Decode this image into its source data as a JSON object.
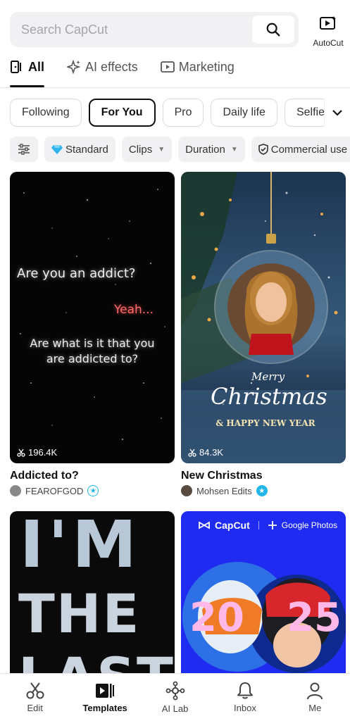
{
  "search": {
    "placeholder": "Search CapCut"
  },
  "autocut": {
    "label": "AutoCut"
  },
  "main_tabs": [
    {
      "label": "All",
      "active": true
    },
    {
      "label": "AI effects",
      "active": false
    },
    {
      "label": "Marketing",
      "active": false
    }
  ],
  "chips": [
    {
      "label": "Following",
      "active": false
    },
    {
      "label": "For You",
      "active": true
    },
    {
      "label": "Pro",
      "active": false
    },
    {
      "label": "Daily life",
      "active": false
    },
    {
      "label": "Selfie",
      "active": false
    }
  ],
  "filters": {
    "standard": "Standard",
    "clips": "Clips",
    "duration": "Duration",
    "commercial": "Commercial use"
  },
  "cards": [
    {
      "title": "Addicted to?",
      "views": "196.4K",
      "author": "FEAROFGOD",
      "lyrics": [
        "Are you an addict?",
        "Yeah...",
        "Are what is it that you",
        "are addicted to?"
      ]
    },
    {
      "title": "New Christmas",
      "views": "84.3K",
      "author": "Mohsen Edits",
      "overlay": [
        "Merry",
        "Christmas",
        "& HAPPY NEW YEAR"
      ]
    },
    {
      "overlay": [
        "I'M",
        "THE",
        "LAST"
      ]
    },
    {
      "brand": "CapCut",
      "partner": "Google Photos",
      "year": [
        "20",
        "25"
      ]
    }
  ],
  "bottom_nav": [
    {
      "label": "Edit",
      "active": false
    },
    {
      "label": "Templates",
      "active": true
    },
    {
      "label": "AI Lab",
      "active": false
    },
    {
      "label": "Inbox",
      "active": false
    },
    {
      "label": "Me",
      "active": false
    }
  ],
  "colors": {
    "accent": "#111111",
    "badge_blue": "#22b5e8",
    "google_card_bg": "#1f2bf0",
    "lyric_red": "#ff6b6b"
  }
}
